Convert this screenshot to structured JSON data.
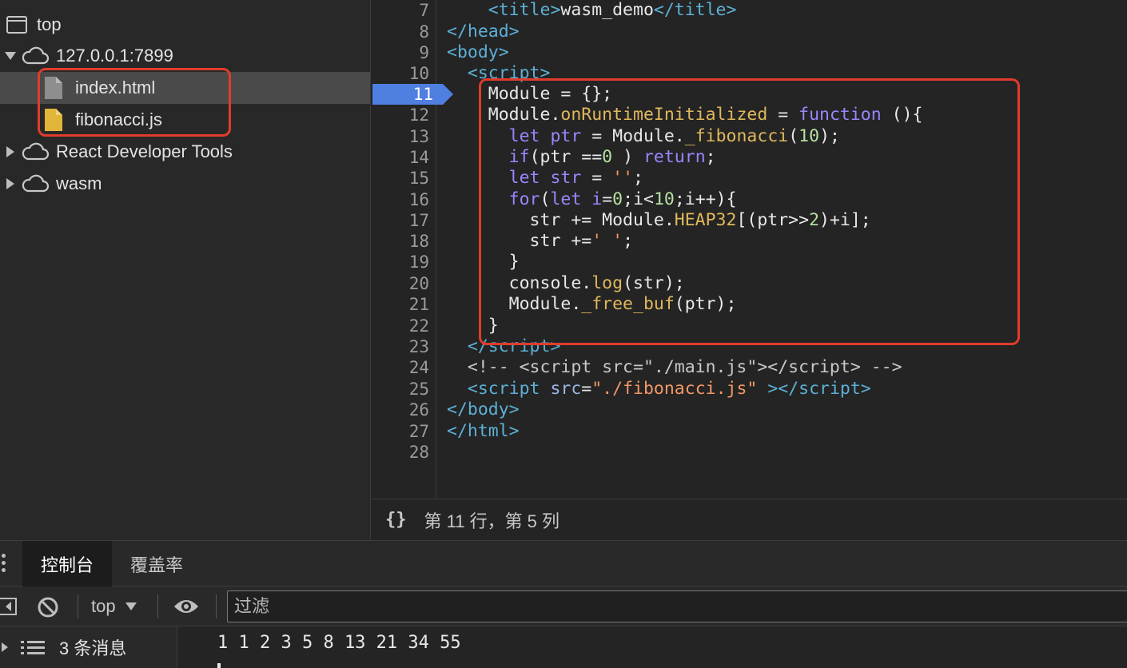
{
  "navigator": {
    "items": [
      {
        "label": "top"
      },
      {
        "label": "127.0.0.1:7899"
      },
      {
        "label": "index.html"
      },
      {
        "label": "fibonacci.js"
      },
      {
        "label": "React Developer Tools"
      },
      {
        "label": "wasm"
      }
    ]
  },
  "editor": {
    "breakpoint_line": "11",
    "line_numbers": [
      "7",
      "8",
      "9",
      "10",
      "12",
      "13",
      "14",
      "15",
      "16",
      "17",
      "18",
      "19",
      "20",
      "21",
      "22",
      "23",
      "24",
      "25",
      "26",
      "27",
      "28"
    ],
    "status": "第 11 行，第 5 列",
    "braces": "{}"
  },
  "drawer": {
    "tabs": [
      "控制台",
      "覆盖率"
    ]
  },
  "console": {
    "context": "top",
    "filter_placeholder": "过滤",
    "message_count": "3 条消息",
    "messages": [
      "1 1 2 3 5 8 13 21 34 55"
    ]
  },
  "colors": {
    "highlight": "#e03c2c",
    "breakpoint": "#4f7fe0"
  }
}
